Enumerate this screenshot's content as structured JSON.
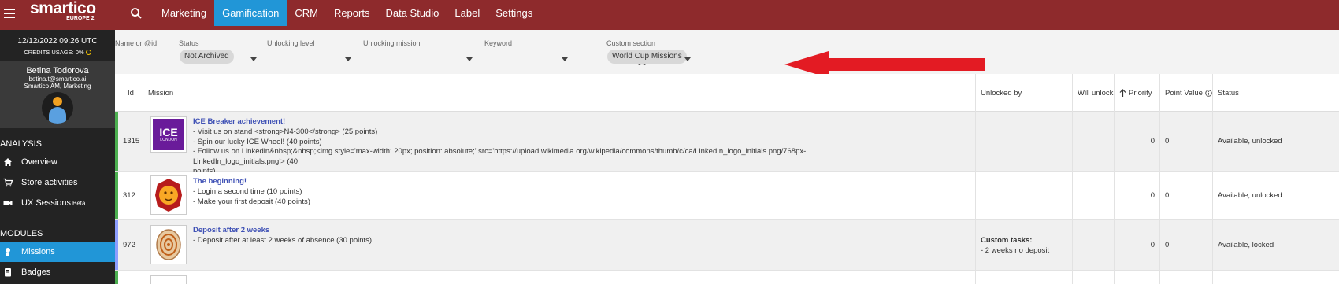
{
  "topbar": {
    "brand": "smartico",
    "region": "EUROPE 2",
    "nav": [
      {
        "label": "Marketing",
        "active": false
      },
      {
        "label": "Gamification",
        "active": true
      },
      {
        "label": "CRM",
        "active": false
      },
      {
        "label": "Reports",
        "active": false
      },
      {
        "label": "Data Studio",
        "active": false
      },
      {
        "label": "Label",
        "active": false
      },
      {
        "label": "Settings",
        "active": false
      }
    ]
  },
  "sidebar": {
    "datetime": "12/12/2022 09:26 UTC",
    "credits": "CREDITS USAGE: 0%",
    "user_name": "Betina Todorova",
    "user_email": "betina.t@smartico.ai",
    "user_role": "Smartico AM, Marketing",
    "section_analysis": "ANALYSIS",
    "analysis_items": [
      "Overview",
      "Store activities",
      "UX Sessions"
    ],
    "beta": "Beta",
    "section_modules": "MODULES",
    "module_items": [
      "Missions",
      "Badges"
    ]
  },
  "filters": {
    "name_label": "Name or @id",
    "status_label": "Status",
    "status_value": "Not Archived",
    "unlock_level_label": "Unlocking level",
    "unlock_mission_label": "Unlocking mission",
    "keyword_label": "Keyword",
    "custom_section_label": "Custom section",
    "custom_section_value": "World Cup Missions"
  },
  "table": {
    "headers": {
      "id": "Id",
      "mission": "Mission",
      "unlocked_by": "Unlocked by",
      "will_unlock": "Will unlock",
      "priority": "Priority",
      "point_value": "Point Value",
      "status": "Status"
    },
    "rows": [
      {
        "id": "1315",
        "title": "ICE Breaker achievement!",
        "thumb": "ICE",
        "thumb_sub": "LONDON",
        "lines": [
          "- Visit us on stand <strong>N4-300</strong> (25 points)",
          "- Spin our lucky ICE Wheel! (40 points)",
          "- Follow us on Linkedin&nbsp;&nbsp;<img style='max-width: 20px; position: absolute;' src='https://upload.wikimedia.org/wikipedia/commons/thumb/c/ca/LinkedIn_logo_initials.png/768px-LinkedIn_logo_initials.png'> (40",
          "points)"
        ],
        "unlocked_title": "",
        "unlocked_line": "",
        "priority": "0",
        "point_value": "0",
        "status": "Available, unlocked"
      },
      {
        "id": "312",
        "title": "The beginning!",
        "thumb": "",
        "thumb_sub": "",
        "lines": [
          "- Login a second time (10 points)",
          "- Make your first deposit (40 points)"
        ],
        "unlocked_title": "",
        "unlocked_line": "",
        "priority": "0",
        "point_value": "0",
        "status": "Available, unlocked"
      },
      {
        "id": "972",
        "title": "Deposit after 2 weeks",
        "thumb": "",
        "thumb_sub": "",
        "lines": [
          "- Deposit after at least 2 weeks of absence (30 points)"
        ],
        "unlocked_title": "Custom tasks:",
        "unlocked_line": "- 2 weeks no deposit",
        "priority": "0",
        "point_value": "0",
        "status": "Available, locked"
      }
    ]
  },
  "colors": {
    "topbar": "#8e2a2c",
    "accent": "#2196d7",
    "row_bar_unlocked": "#4caf50",
    "row_bar_locked": "#8c9eff",
    "arrow": "#e31b23"
  }
}
